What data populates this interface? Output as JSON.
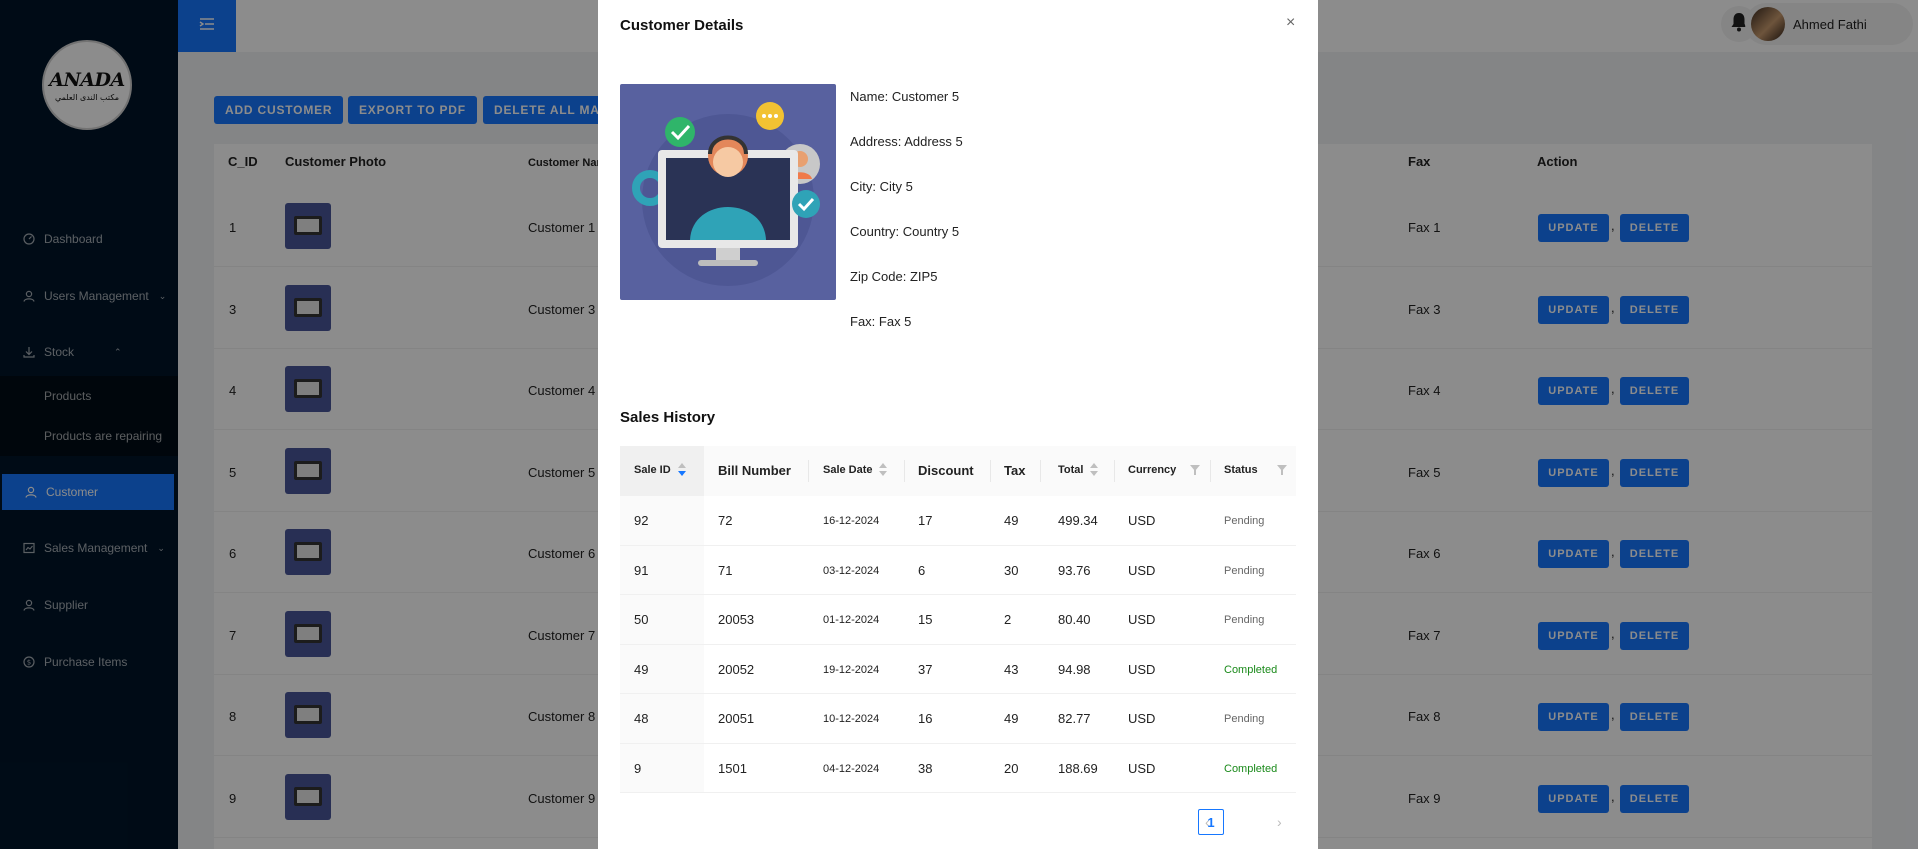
{
  "header": {
    "user_name": "Ahmed Fathi"
  },
  "logo": {
    "brand_text": "ANADA",
    "arabic_text": "مكتب الندى العلمي"
  },
  "sidebar": {
    "items": [
      {
        "label": "Dashboard",
        "icon": "dashboard-icon"
      },
      {
        "label": "Users Management",
        "icon": "user-icon"
      },
      {
        "label": "Stock",
        "icon": "download-icon"
      },
      {
        "label": "Products",
        "icon": ""
      },
      {
        "label": "Products are repairing",
        "icon": ""
      },
      {
        "label": "Customer",
        "icon": "user-icon"
      },
      {
        "label": "Sales Management",
        "icon": "sales-icon"
      },
      {
        "label": "Supplier",
        "icon": "user-icon"
      },
      {
        "label": "Purchase Items",
        "icon": "dollar-icon"
      }
    ]
  },
  "toolbar": {
    "add_customer": "ADD CUSTOMER",
    "export_pdf": "EXPORT TO PDF",
    "delete_all": "DELETE ALL MAR"
  },
  "customers_table": {
    "headers": {
      "id": "C_ID",
      "photo": "Customer Photo",
      "name": "Customer Nam",
      "fax": "Fax",
      "action": "Action"
    },
    "rows": [
      {
        "id": "1",
        "name": "Customer 1",
        "fax": "Fax 1"
      },
      {
        "id": "3",
        "name": "Customer 3",
        "fax": "Fax 3"
      },
      {
        "id": "4",
        "name": "Customer 4",
        "fax": "Fax 4"
      },
      {
        "id": "5",
        "name": "Customer 5",
        "fax": "Fax 5"
      },
      {
        "id": "6",
        "name": "Customer 6",
        "fax": "Fax 6"
      },
      {
        "id": "7",
        "name": "Customer 7",
        "fax": "Fax 7"
      },
      {
        "id": "8",
        "name": "Customer 8",
        "fax": "Fax 8"
      },
      {
        "id": "9",
        "name": "Customer 9",
        "fax": "Fax 9"
      }
    ],
    "update_label": "UPDATE",
    "separator": ",",
    "delete_label": "DELETE"
  },
  "modal": {
    "title": "Customer Details",
    "close": "×",
    "details": [
      "Name: Customer 5",
      "Address: Address 5",
      "City: City 5",
      "Country: Country 5",
      "Zip Code: ZIP5",
      "Fax: Fax 5"
    ],
    "sales_history_title": "Sales History",
    "sales_headers": {
      "sale_id": "Sale ID",
      "bill_number": "Bill Number",
      "sale_date": "Sale Date",
      "discount": "Discount",
      "tax": "Tax",
      "total": "Total",
      "currency": "Currency",
      "status": "Status"
    },
    "sales_rows": [
      {
        "sale_id": "92",
        "bill": "72",
        "date": "16-12-2024",
        "discount": "17",
        "tax": "49",
        "total": "499.34",
        "currency": "USD",
        "status": "Pending"
      },
      {
        "sale_id": "91",
        "bill": "71",
        "date": "03-12-2024",
        "discount": "6",
        "tax": "30",
        "total": "93.76",
        "currency": "USD",
        "status": "Pending"
      },
      {
        "sale_id": "50",
        "bill": "20053",
        "date": "01-12-2024",
        "discount": "15",
        "tax": "2",
        "total": "80.40",
        "currency": "USD",
        "status": "Pending"
      },
      {
        "sale_id": "49",
        "bill": "20052",
        "date": "19-12-2024",
        "discount": "37",
        "tax": "43",
        "total": "94.98",
        "currency": "USD",
        "status": "Completed"
      },
      {
        "sale_id": "48",
        "bill": "20051",
        "date": "10-12-2024",
        "discount": "16",
        "tax": "49",
        "total": "82.77",
        "currency": "USD",
        "status": "Pending"
      },
      {
        "sale_id": "9",
        "bill": "1501",
        "date": "04-12-2024",
        "discount": "38",
        "tax": "20",
        "total": "188.69",
        "currency": "USD",
        "status": "Completed"
      }
    ],
    "pagination": {
      "prev": "‹",
      "current": "1",
      "next": "›"
    }
  },
  "colors": {
    "primary": "#1677ff",
    "sidebar": "#001529",
    "completed": "#1a8a1a"
  }
}
